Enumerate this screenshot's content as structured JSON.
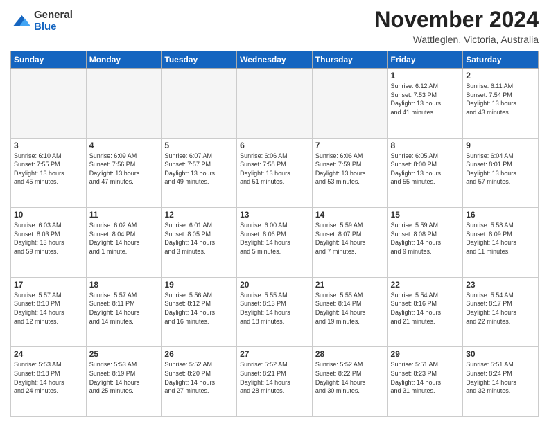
{
  "header": {
    "logo_general": "General",
    "logo_blue": "Blue",
    "month_title": "November 2024",
    "location": "Wattleglen, Victoria, Australia"
  },
  "days_of_week": [
    "Sunday",
    "Monday",
    "Tuesday",
    "Wednesday",
    "Thursday",
    "Friday",
    "Saturday"
  ],
  "weeks": [
    [
      {
        "day": "",
        "info": ""
      },
      {
        "day": "",
        "info": ""
      },
      {
        "day": "",
        "info": ""
      },
      {
        "day": "",
        "info": ""
      },
      {
        "day": "",
        "info": ""
      },
      {
        "day": "1",
        "info": "Sunrise: 6:12 AM\nSunset: 7:53 PM\nDaylight: 13 hours\nand 41 minutes."
      },
      {
        "day": "2",
        "info": "Sunrise: 6:11 AM\nSunset: 7:54 PM\nDaylight: 13 hours\nand 43 minutes."
      }
    ],
    [
      {
        "day": "3",
        "info": "Sunrise: 6:10 AM\nSunset: 7:55 PM\nDaylight: 13 hours\nand 45 minutes."
      },
      {
        "day": "4",
        "info": "Sunrise: 6:09 AM\nSunset: 7:56 PM\nDaylight: 13 hours\nand 47 minutes."
      },
      {
        "day": "5",
        "info": "Sunrise: 6:07 AM\nSunset: 7:57 PM\nDaylight: 13 hours\nand 49 minutes."
      },
      {
        "day": "6",
        "info": "Sunrise: 6:06 AM\nSunset: 7:58 PM\nDaylight: 13 hours\nand 51 minutes."
      },
      {
        "day": "7",
        "info": "Sunrise: 6:06 AM\nSunset: 7:59 PM\nDaylight: 13 hours\nand 53 minutes."
      },
      {
        "day": "8",
        "info": "Sunrise: 6:05 AM\nSunset: 8:00 PM\nDaylight: 13 hours\nand 55 minutes."
      },
      {
        "day": "9",
        "info": "Sunrise: 6:04 AM\nSunset: 8:01 PM\nDaylight: 13 hours\nand 57 minutes."
      }
    ],
    [
      {
        "day": "10",
        "info": "Sunrise: 6:03 AM\nSunset: 8:03 PM\nDaylight: 13 hours\nand 59 minutes."
      },
      {
        "day": "11",
        "info": "Sunrise: 6:02 AM\nSunset: 8:04 PM\nDaylight: 14 hours\nand 1 minute."
      },
      {
        "day": "12",
        "info": "Sunrise: 6:01 AM\nSunset: 8:05 PM\nDaylight: 14 hours\nand 3 minutes."
      },
      {
        "day": "13",
        "info": "Sunrise: 6:00 AM\nSunset: 8:06 PM\nDaylight: 14 hours\nand 5 minutes."
      },
      {
        "day": "14",
        "info": "Sunrise: 5:59 AM\nSunset: 8:07 PM\nDaylight: 14 hours\nand 7 minutes."
      },
      {
        "day": "15",
        "info": "Sunrise: 5:59 AM\nSunset: 8:08 PM\nDaylight: 14 hours\nand 9 minutes."
      },
      {
        "day": "16",
        "info": "Sunrise: 5:58 AM\nSunset: 8:09 PM\nDaylight: 14 hours\nand 11 minutes."
      }
    ],
    [
      {
        "day": "17",
        "info": "Sunrise: 5:57 AM\nSunset: 8:10 PM\nDaylight: 14 hours\nand 12 minutes."
      },
      {
        "day": "18",
        "info": "Sunrise: 5:57 AM\nSunset: 8:11 PM\nDaylight: 14 hours\nand 14 minutes."
      },
      {
        "day": "19",
        "info": "Sunrise: 5:56 AM\nSunset: 8:12 PM\nDaylight: 14 hours\nand 16 minutes."
      },
      {
        "day": "20",
        "info": "Sunrise: 5:55 AM\nSunset: 8:13 PM\nDaylight: 14 hours\nand 18 minutes."
      },
      {
        "day": "21",
        "info": "Sunrise: 5:55 AM\nSunset: 8:14 PM\nDaylight: 14 hours\nand 19 minutes."
      },
      {
        "day": "22",
        "info": "Sunrise: 5:54 AM\nSunset: 8:16 PM\nDaylight: 14 hours\nand 21 minutes."
      },
      {
        "day": "23",
        "info": "Sunrise: 5:54 AM\nSunset: 8:17 PM\nDaylight: 14 hours\nand 22 minutes."
      }
    ],
    [
      {
        "day": "24",
        "info": "Sunrise: 5:53 AM\nSunset: 8:18 PM\nDaylight: 14 hours\nand 24 minutes."
      },
      {
        "day": "25",
        "info": "Sunrise: 5:53 AM\nSunset: 8:19 PM\nDaylight: 14 hours\nand 25 minutes."
      },
      {
        "day": "26",
        "info": "Sunrise: 5:52 AM\nSunset: 8:20 PM\nDaylight: 14 hours\nand 27 minutes."
      },
      {
        "day": "27",
        "info": "Sunrise: 5:52 AM\nSunset: 8:21 PM\nDaylight: 14 hours\nand 28 minutes."
      },
      {
        "day": "28",
        "info": "Sunrise: 5:52 AM\nSunset: 8:22 PM\nDaylight: 14 hours\nand 30 minutes."
      },
      {
        "day": "29",
        "info": "Sunrise: 5:51 AM\nSunset: 8:23 PM\nDaylight: 14 hours\nand 31 minutes."
      },
      {
        "day": "30",
        "info": "Sunrise: 5:51 AM\nSunset: 8:24 PM\nDaylight: 14 hours\nand 32 minutes."
      }
    ]
  ]
}
